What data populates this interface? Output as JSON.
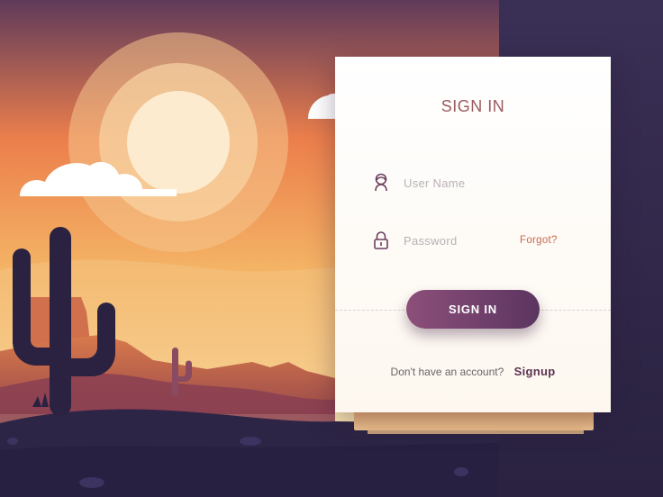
{
  "colors": {
    "sky_top": "#5f3a5a",
    "sky_mid": "#ec7f4c",
    "sun": "#fdebd0",
    "dark_ground": "#2d2545",
    "accent": "#9b5a5e",
    "button_start": "#8c4f7a",
    "button_end": "#5b3560",
    "forgot": "#c9684a"
  },
  "form": {
    "title": "SIGN IN",
    "username": {
      "placeholder": "User Name",
      "icon": "user-icon"
    },
    "password": {
      "placeholder": "Password",
      "icon": "lock-icon"
    },
    "forgot_label": "Forgot?",
    "submit_label": "SIGN IN",
    "footer_question": "Don't have an account?",
    "signup_label": "Signup"
  }
}
